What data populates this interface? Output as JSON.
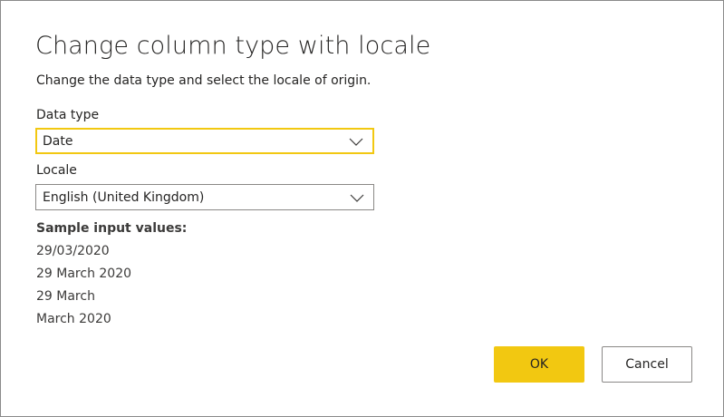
{
  "dialog": {
    "title": "Change column type with locale",
    "subtitle": "Change the data type and select the locale of origin."
  },
  "data_type": {
    "label": "Data type",
    "value": "Date"
  },
  "locale": {
    "label": "Locale",
    "value": "English (United Kingdom)"
  },
  "samples": {
    "label": "Sample input values:",
    "values": [
      "29/03/2020",
      "29 March 2020",
      "29 March",
      "March 2020"
    ]
  },
  "buttons": {
    "ok": "OK",
    "cancel": "Cancel"
  },
  "colors": {
    "accent": "#f2c811",
    "border": "#8a8886",
    "text": "#252423"
  },
  "icons": {
    "dropdown": "chevron-down-icon"
  }
}
